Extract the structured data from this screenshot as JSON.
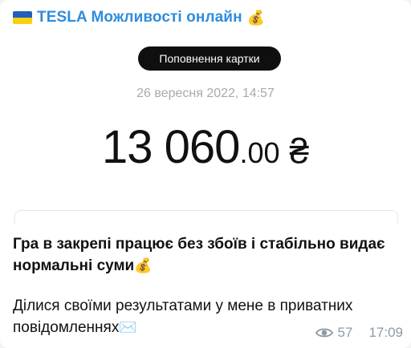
{
  "channel": {
    "name": "TESLA Можливості онлайн",
    "flag_icon": "ukraine-flag-icon",
    "emoji_icon": "money-bag-icon"
  },
  "receipt": {
    "pill_label": "Поповнення картки",
    "date": "26 вересня 2022, 14:57",
    "amount_main": "13 060",
    "amount_cents": ".00",
    "currency": "₴"
  },
  "message": {
    "line1": "Гра в закрепі працює без збоїв і стабільно видає нормальні суми",
    "line1_emoji": "💰",
    "line2": "Ділися своїми результатами у мене в приватних повідомленнях",
    "line2_emoji": "✉️"
  },
  "meta": {
    "views": "57",
    "time": "17:09",
    "views_icon": "eye-icon"
  },
  "colors": {
    "channel": "#2f8cdd",
    "pill": "#0f0f10",
    "meta": "#8e9aa6"
  }
}
